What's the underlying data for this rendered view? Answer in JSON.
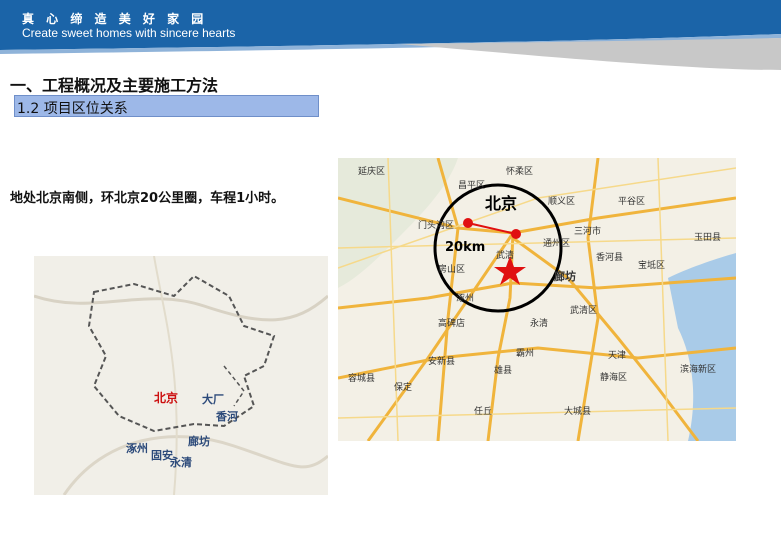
{
  "header": {
    "brand_cn": "真 心 缔 造 美 好 家 园",
    "brand_en": "Create sweet homes with sincere hearts"
  },
  "section_title": "一、工程概况及主要施工方法",
  "subsection_title": "1.2 项目区位关系",
  "description": "地处北京南侧，环北京20公里圈，车程1小时。",
  "left_map": {
    "labels": {
      "beijing": "北京",
      "dachang": "大厂",
      "xianghe": "香河",
      "zhuozhou": "涿州",
      "guan": "固安",
      "langfang": "廊坊",
      "yongqing": "永清"
    }
  },
  "right_map": {
    "city_label": "北京",
    "distance_label": "20km",
    "place_labels": {
      "wuqing": "武清",
      "langfang": "廊坊",
      "tianjin": "天津",
      "baoding": "保定",
      "renqiu": "任丘",
      "bazhou": "霸州",
      "gaobeidian": "高碑店",
      "zhuozhou": "涿州",
      "yongqing": "永清",
      "dacheng": "大城县",
      "xiong": "雄县",
      "anxin": "安新县",
      "rongcheng": "容城县",
      "shunyi": "顺义区",
      "pinggu": "平谷区",
      "sanhe": "三河市",
      "xianghe": "香河县",
      "baodi": "宝坻区",
      "yutian": "玉田县",
      "wuqing2": "武清区",
      "binhai": "滨海新区",
      "jinghai": "静海区",
      "fangshan": "房山区",
      "mentougou": "门头沟区",
      "huairou": "怀柔区",
      "yanqing": "延庆区",
      "changping": "昌平区",
      "tongzhou": "通州区"
    }
  },
  "colors": {
    "banner_blue": "#1b64a8",
    "subbar_fill": "#9db8e8",
    "marker_red": "#e01010"
  }
}
